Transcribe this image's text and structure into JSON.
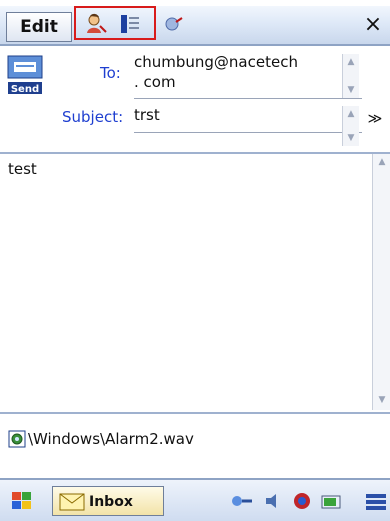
{
  "toolbar": {
    "edit_label": "Edit",
    "close_glyph": "×",
    "icons": [
      "contact-picker-icon",
      "recipient-list-icon",
      "check-names-icon"
    ]
  },
  "header": {
    "to_label": "To:",
    "to_value_line1": "chumbung@nacetech",
    "to_value_line2": ". com",
    "subject_label": "Subject:",
    "subject_value": "trst",
    "send_label": "Send",
    "expand_glyph": "≫"
  },
  "body": {
    "text": "test"
  },
  "attachment": {
    "path": "\\Windows\\Alarm2.wav"
  },
  "taskbar": {
    "inbox_label": "Inbox"
  },
  "colors": {
    "label_blue": "#1f3fd0",
    "highlight_red": "#d81b1b",
    "toolbar_blue": "#c9d7ec"
  }
}
